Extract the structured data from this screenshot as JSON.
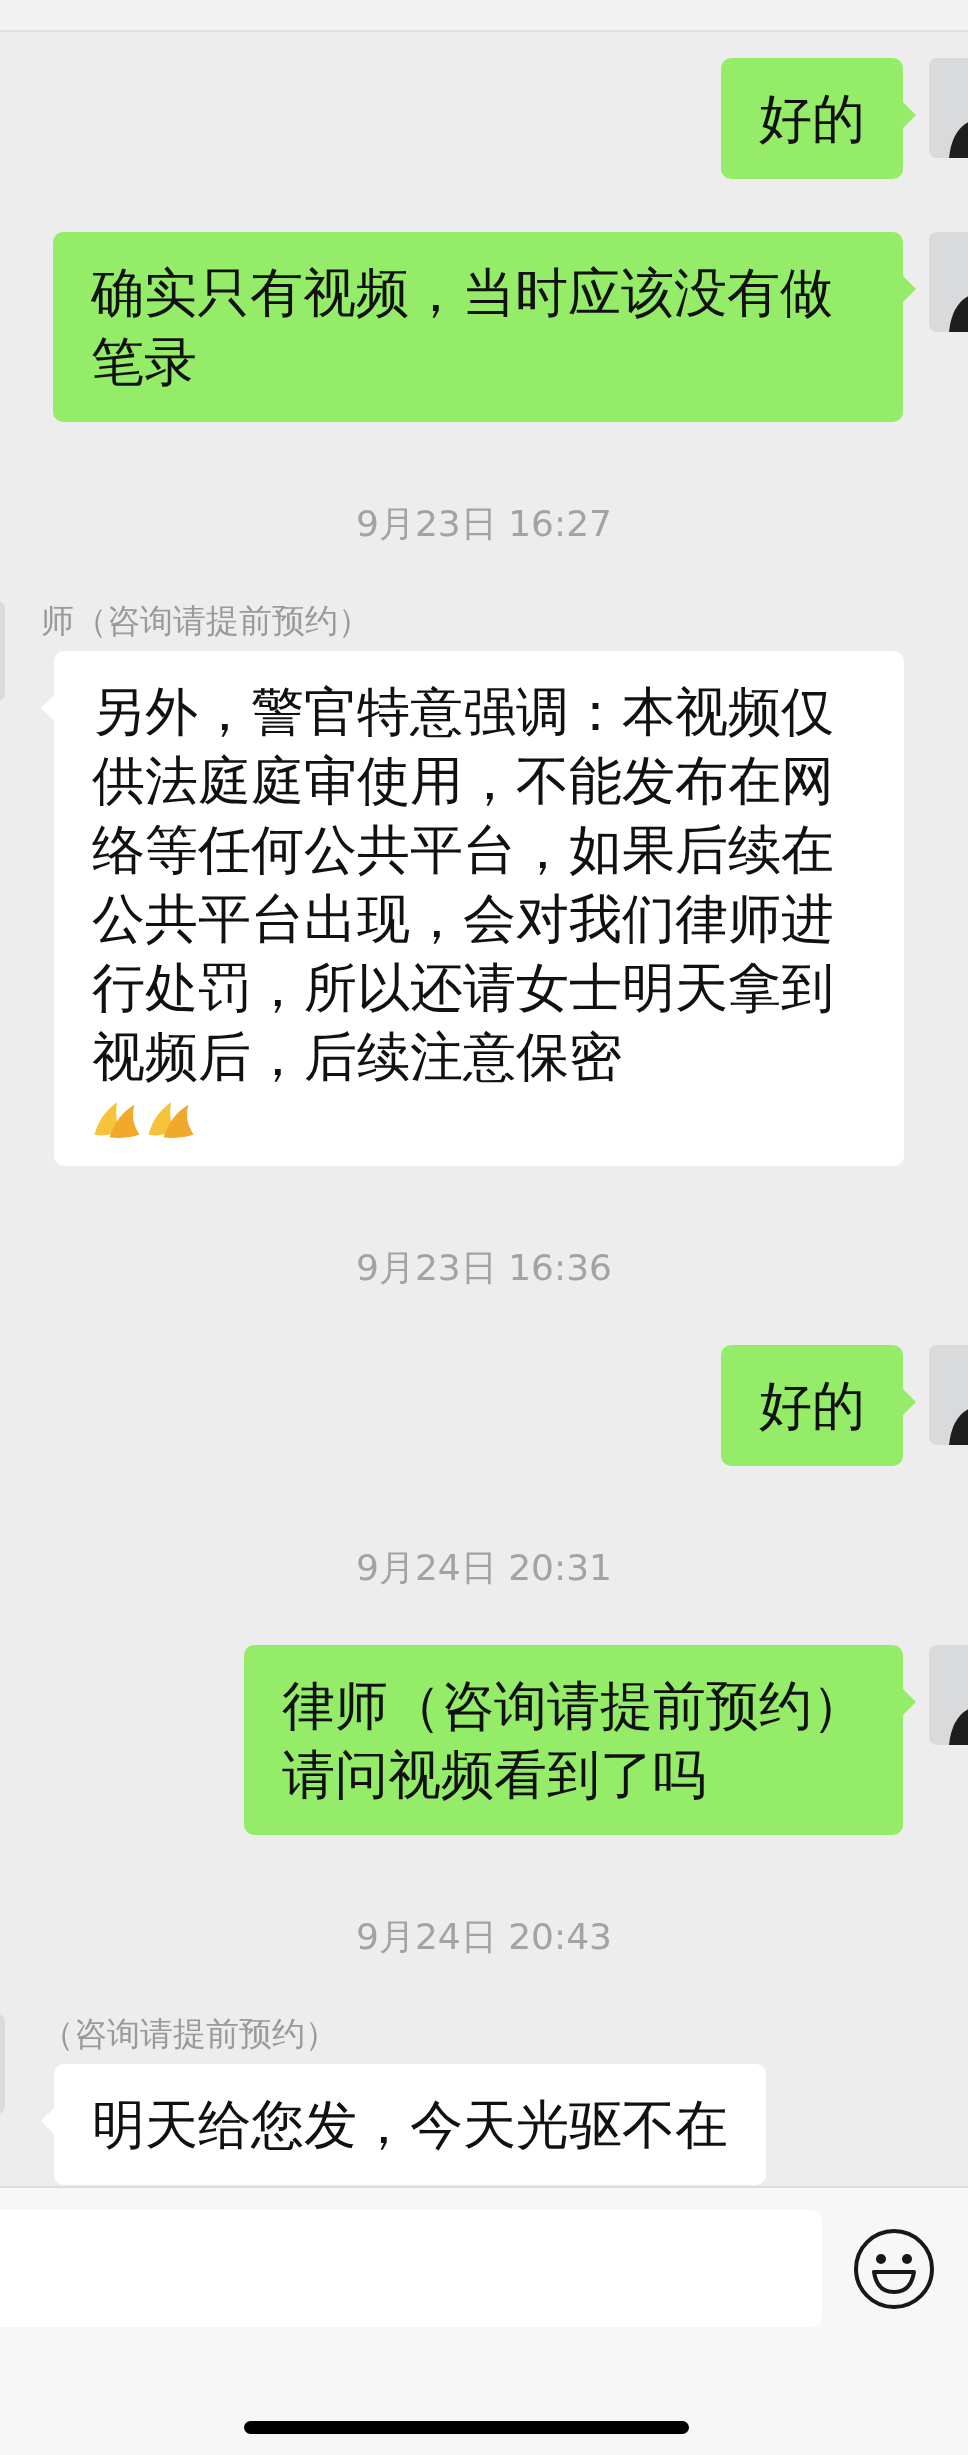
{
  "messages": [
    {
      "kind": "message",
      "outgoing": true,
      "text": "好的"
    },
    {
      "kind": "message",
      "outgoing": true,
      "text": "确实只有视频，当时应该没有做笔录"
    },
    {
      "kind": "time",
      "text": "9月23日 16:27"
    },
    {
      "kind": "message",
      "outgoing": false,
      "sender": "师（咨询请提前预约）",
      "text": "另外，警官特意强调：本视频仅供法庭庭审使用，不能发布在网络等任何公共平台，如果后续在公共平台出现，会对我们律师进行处罚，所以还请女士明天拿到视频后，后续注意保密",
      "emoji": [
        {
          "kind": "praying-hands"
        },
        {
          "kind": "praying-hands"
        }
      ]
    },
    {
      "kind": "time",
      "text": "9月23日 16:36"
    },
    {
      "kind": "message",
      "outgoing": true,
      "text": "好的"
    },
    {
      "kind": "time",
      "text": "9月24日 20:31"
    },
    {
      "kind": "message",
      "outgoing": true,
      "lines": [
        "律师（咨询请提前预约）",
        "请问视频看到了吗"
      ]
    },
    {
      "kind": "time",
      "text": "9月24日 20:43"
    },
    {
      "kind": "message",
      "outgoing": false,
      "sender": "（咨询请提前预约）",
      "text": "明天给您发，今天光驱不在"
    }
  ]
}
